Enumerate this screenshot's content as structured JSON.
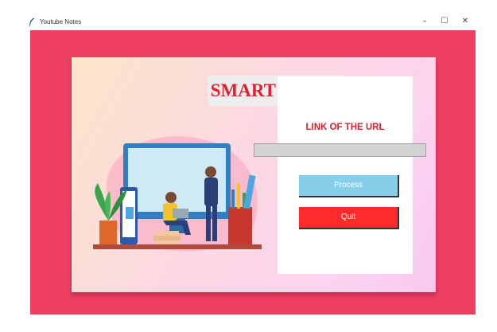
{
  "window": {
    "title": "Youtube Notes",
    "controls": {
      "minimize": "–",
      "maximize": "☐",
      "close": "✕"
    }
  },
  "app": {
    "heading": "SMART NOTES",
    "url_label": "LINK OF THE URL",
    "url_value": "",
    "process_label": "Process",
    "quit_label": "Quit"
  },
  "colors": {
    "background": "#ee3f63",
    "title": "#e02030",
    "process_button": "#87ceeb",
    "quit_button": "#ff2a2a"
  },
  "icons": {
    "app": "feather-icon",
    "illustration": "people-studying-illustration"
  }
}
